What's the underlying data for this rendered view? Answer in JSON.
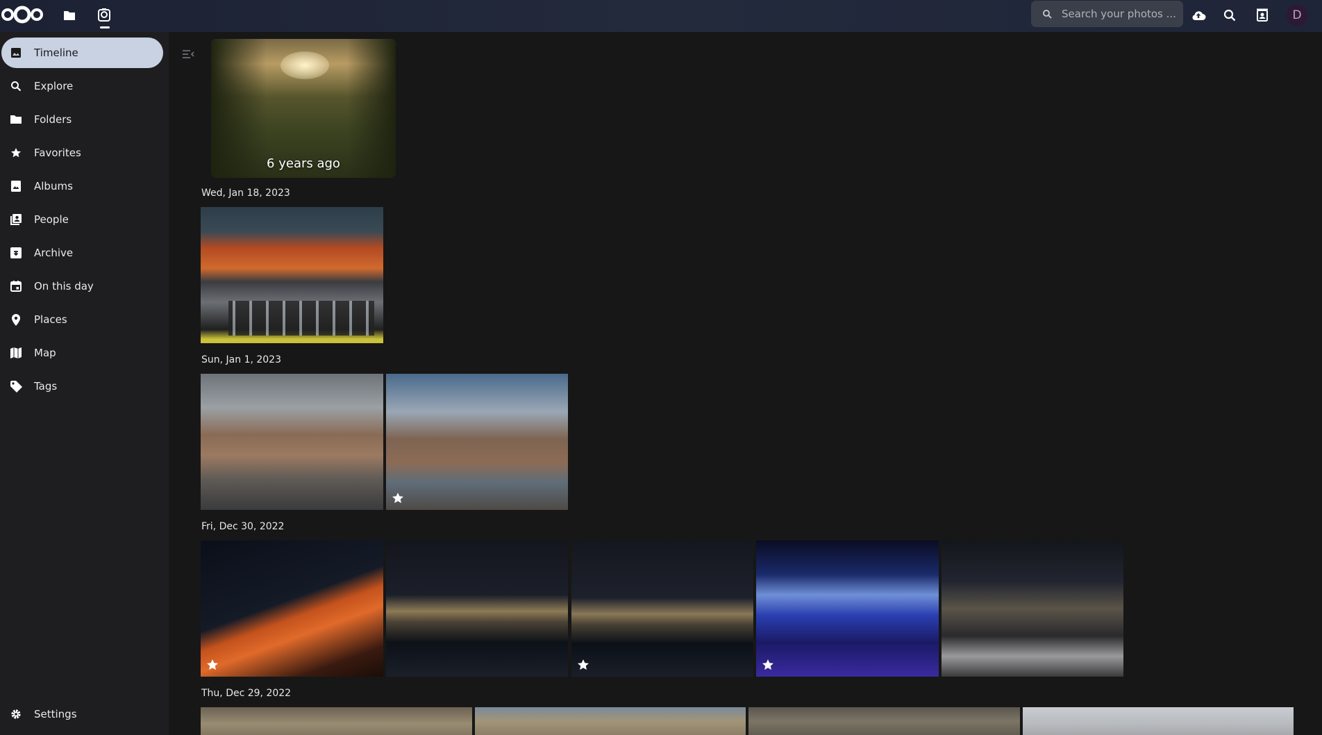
{
  "header": {
    "search_placeholder": "Search your photos ...",
    "avatar_initial": "D"
  },
  "sidebar": {
    "items": [
      {
        "label": "Timeline",
        "icon": "image-icon"
      },
      {
        "label": "Explore",
        "icon": "search-icon"
      },
      {
        "label": "Folders",
        "icon": "folder-icon"
      },
      {
        "label": "Favorites",
        "icon": "star-icon"
      },
      {
        "label": "Albums",
        "icon": "album-icon"
      },
      {
        "label": "People",
        "icon": "people-icon"
      },
      {
        "label": "Archive",
        "icon": "archive-icon"
      },
      {
        "label": "On this day",
        "icon": "calendar-icon"
      },
      {
        "label": "Places",
        "icon": "map-marker-icon"
      },
      {
        "label": "Map",
        "icon": "map-icon"
      },
      {
        "label": "Tags",
        "icon": "tag-icon"
      }
    ],
    "settings_label": "Settings"
  },
  "timeline": {
    "memory_caption": "6 years ago",
    "groups": [
      {
        "date": "Wed, Jan 18, 2023"
      },
      {
        "date": "Sun, Jan 1, 2023"
      },
      {
        "date": "Fri, Dec 30, 2022"
      },
      {
        "date": "Thu, Dec 29, 2022"
      }
    ]
  },
  "colors": {
    "header_bg": "#1f2538",
    "sidebar_bg": "#1e1e20",
    "content_bg": "#171717",
    "active_nav_bg": "#c8d2e3"
  }
}
